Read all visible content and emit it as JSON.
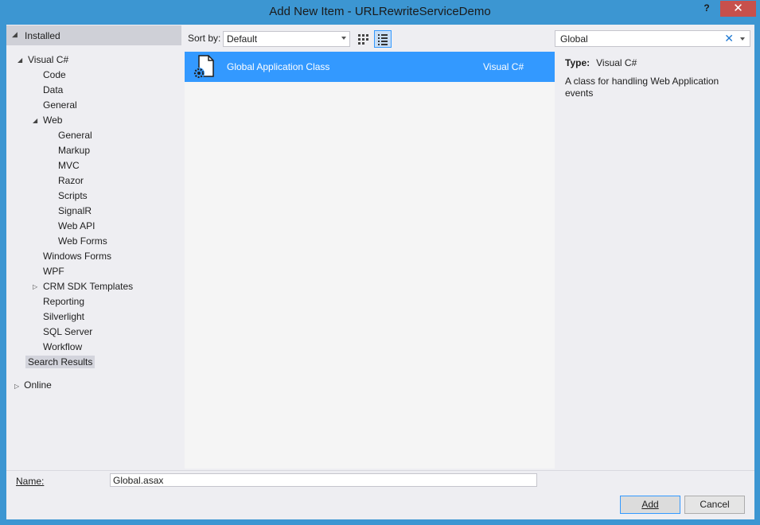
{
  "window": {
    "title": "Add New Item - URLRewriteServiceDemo",
    "help": "?",
    "close": "✕"
  },
  "left": {
    "installed": "Installed",
    "tree": [
      {
        "label": "Visual C#",
        "level": 0,
        "twisty": "expanded"
      },
      {
        "label": "Code",
        "level": 1
      },
      {
        "label": "Data",
        "level": 1
      },
      {
        "label": "General",
        "level": 1
      },
      {
        "label": "Web",
        "level": 1,
        "twisty": "expanded"
      },
      {
        "label": "General",
        "level": 2
      },
      {
        "label": "Markup",
        "level": 2
      },
      {
        "label": "MVC",
        "level": 2
      },
      {
        "label": "Razor",
        "level": 2
      },
      {
        "label": "Scripts",
        "level": 2
      },
      {
        "label": "SignalR",
        "level": 2
      },
      {
        "label": "Web API",
        "level": 2
      },
      {
        "label": "Web Forms",
        "level": 2
      },
      {
        "label": "Windows Forms",
        "level": 1
      },
      {
        "label": "WPF",
        "level": 1
      },
      {
        "label": "CRM SDK Templates",
        "level": 1,
        "twisty": "collapsed"
      },
      {
        "label": "Reporting",
        "level": 1
      },
      {
        "label": "Silverlight",
        "level": 1
      },
      {
        "label": "SQL Server",
        "level": 1
      },
      {
        "label": "Workflow",
        "level": 1
      },
      {
        "label": "Search Results",
        "level": 0,
        "selected": true
      }
    ],
    "online": "Online"
  },
  "toolbar": {
    "sort_label": "Sort by:",
    "sort_value": "Default",
    "search_value": "Global",
    "search_clear": "✕"
  },
  "items": [
    {
      "name": "Global Application Class",
      "language": "Visual C#",
      "icon": "global-asax-file-icon"
    }
  ],
  "details": {
    "type_label": "Type:",
    "type_value": "Visual C#",
    "description": "A class for handling Web Application events"
  },
  "footer": {
    "name_label": "Name:",
    "name_value": "Global.asax",
    "add_label": "Add",
    "cancel_label": "Cancel"
  },
  "colors": {
    "frame": "#3c96d2",
    "selection": "#3399ff",
    "close": "#c7504c"
  }
}
